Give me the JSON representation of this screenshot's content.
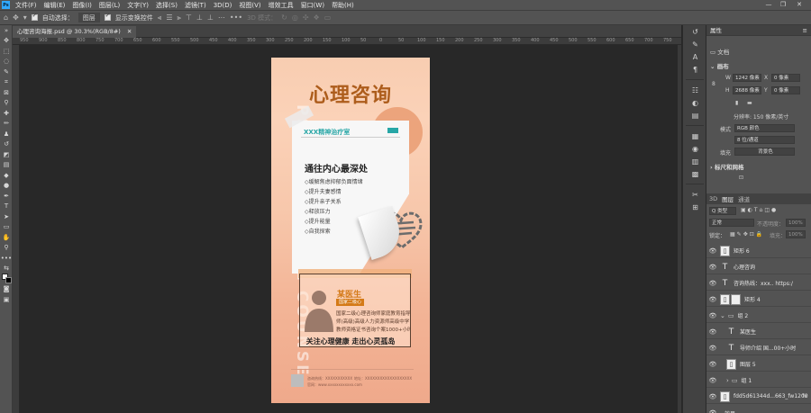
{
  "menubar": {
    "logo": "Ps",
    "items": [
      "文件(F)",
      "编辑(E)",
      "图像(I)",
      "图层(L)",
      "文字(Y)",
      "选择(S)",
      "滤镜(T)",
      "3D(D)",
      "视图(V)",
      "增效工具",
      "窗口(W)",
      "帮助(H)"
    ],
    "controls": [
      "—",
      "❐",
      "✕"
    ]
  },
  "options": {
    "auto_select_label": "自动选择：",
    "auto_select_value": "图层",
    "show_transform_label": "显示变换控件",
    "mode_3d_label": "3D 模式："
  },
  "document": {
    "tab_label": "心理咨询海报.psd @ 30.3%(RGB/8#)",
    "tab_close": "✕"
  },
  "ruler": {
    "ticks": [
      "950",
      "900",
      "850",
      "800",
      "750",
      "700",
      "650",
      "600",
      "550",
      "500",
      "450",
      "400",
      "350",
      "300",
      "250",
      "200",
      "150",
      "100",
      "50",
      "0",
      "50",
      "100",
      "150",
      "200",
      "250",
      "300",
      "350",
      "400",
      "450",
      "500",
      "550",
      "600",
      "650",
      "700",
      "750"
    ]
  },
  "poster": {
    "title": "心理咨询",
    "vertical_text": "PSYCHOLOGICAL COUNSELING",
    "card_heading": "XXX精神治疗室",
    "card_title": "通往内心最深处",
    "items": [
      "◇缓解焦虑抑郁负面情绪",
      "◇提升夫妻感情",
      "◇提升亲子关系",
      "◇释放压力",
      "◇提升能量",
      "◇自我探索"
    ],
    "doctor_name": "某医生",
    "doctor_sub": "国家二级心",
    "doctor_desc": [
      "国家二级心理咨询师家庭教育指导",
      "师(高级)高级人力资源师高级中学",
      "教师资格证书咨询个案1000+小时"
    ],
    "slogan": "关注心理健康  走出心灵孤岛",
    "footer_phone": "咨询热线：XXXXXXXXXXX",
    "footer_addr": "地址：XXXXXXXXXXXXXXXXXXX",
    "footer_web": "官网：www.xxxxxxxxxxxx.com"
  },
  "properties": {
    "panel_title": "属性",
    "tab_doc": "文档",
    "canvas_section": "画布",
    "width_label": "W",
    "width_value": "1242 像素",
    "height_label": "H",
    "height_value": "2688 像素",
    "x_label": "X",
    "x_value": "0 像素",
    "y_label": "Y",
    "y_value": "0 像素",
    "resolution": "分辨率: 150 像素/英寸",
    "mode_label": "模式",
    "mode_value": "RGB 颜色",
    "bit_value": "8 位/通道",
    "fill_label": "填充",
    "fill_value": "背景色",
    "guides_section": "标尺和网格"
  },
  "layers": {
    "tab_3d": "3D",
    "tab_layers": "图层",
    "tab_channels": "通道",
    "filter_label": "Q 类型",
    "blend_mode": "正常",
    "opacity_label": "不透明度：",
    "opacity_value": "100%",
    "lock_label": "锁定：",
    "fill_label": "填充：",
    "fill_value": "100%",
    "rows": [
      {
        "name": "矩形 6",
        "type": "shape",
        "fx": ""
      },
      {
        "name": "心理咨询",
        "type": "text",
        "fx": ""
      },
      {
        "name": "咨询热线：xxx.. https:/",
        "type": "text",
        "fx": ""
      },
      {
        "name": "矩形 4",
        "type": "shape",
        "fx": ""
      },
      {
        "name": "组 2",
        "type": "group",
        "fx": ""
      },
      {
        "name": "某医生",
        "type": "text",
        "fx": ""
      },
      {
        "name": "导师介绍 国...00+小时",
        "type": "text",
        "fx": ""
      },
      {
        "name": "图层 5",
        "type": "image",
        "fx": ""
      },
      {
        "name": "组 1",
        "type": "group",
        "fx": ""
      },
      {
        "name": "fdd5d61344d...663_fw1200",
        "type": "image",
        "fx": "fx"
      },
      {
        "name": "效果",
        "type": "effect",
        "fx": ""
      }
    ]
  }
}
